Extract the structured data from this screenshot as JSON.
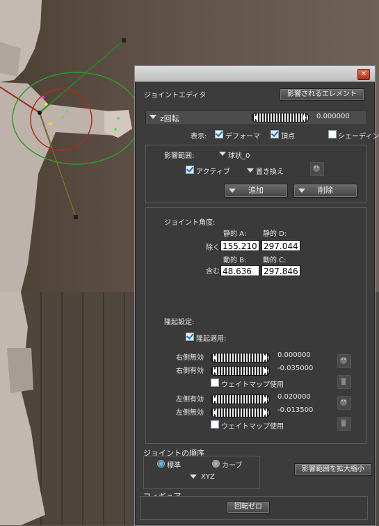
{
  "dialog": {
    "panel_title": "ジョイントエディタ",
    "affected_elements_button": "影響されるエレメント",
    "rotation_label": "z回転",
    "rotation_value": "0.000000",
    "display_label": "表示:",
    "display_options": [
      {
        "label": "デフォーマ",
        "checked": true
      },
      {
        "label": "頂点",
        "checked": true
      },
      {
        "label": "シェーディン",
        "checked": false
      }
    ],
    "influence": {
      "range_label": "影響範囲:",
      "range_value": "球状_0",
      "active_label": "アクティブ",
      "active_checked": true,
      "replace_label": "置き換え",
      "add_button": "追加",
      "delete_button": "削除"
    },
    "joint_angle": {
      "title": "ジョイント角度:",
      "static_a": "静的 A:",
      "static_d": "静的 D:",
      "exclude_label": "除く:",
      "dynamic_b": "動的 B:",
      "dynamic_c": "動的 C:",
      "include_label": "含む:",
      "values": {
        "a": "155.210",
        "d": "297.044",
        "b": "48.636",
        "c": "297.846"
      }
    },
    "bulge": {
      "title": "隆起設定:",
      "apply_label": "隆起適用:",
      "apply_checked": true,
      "right_off_label": "右側無効",
      "right_off_value": "0.000000",
      "right_on_label": "右側有効",
      "right_on_value": "-0.035000",
      "right_weightmap": "ウェイトマップ使用",
      "left_on_label": "左側有効",
      "left_on_value": "0.020000",
      "left_off_label": "左側無効",
      "left_off_value": "-0.013500",
      "left_weightmap": "ウェイトマップ使用"
    },
    "joint_order": {
      "title": "ジョイントの順序",
      "standard_label": "標準",
      "curve_label": "カーブ",
      "selected": "標準",
      "order_value": "XYZ"
    },
    "scale_range_button": "影響範囲を拡大縮小",
    "figure": {
      "title": "フィギュア",
      "zero_rotation_button": "回転ゼロ"
    }
  },
  "colors": {
    "accent_yellow": "#f0d25a",
    "dialog_bg": "#3c3c3c",
    "close_red": "#c8402a"
  }
}
